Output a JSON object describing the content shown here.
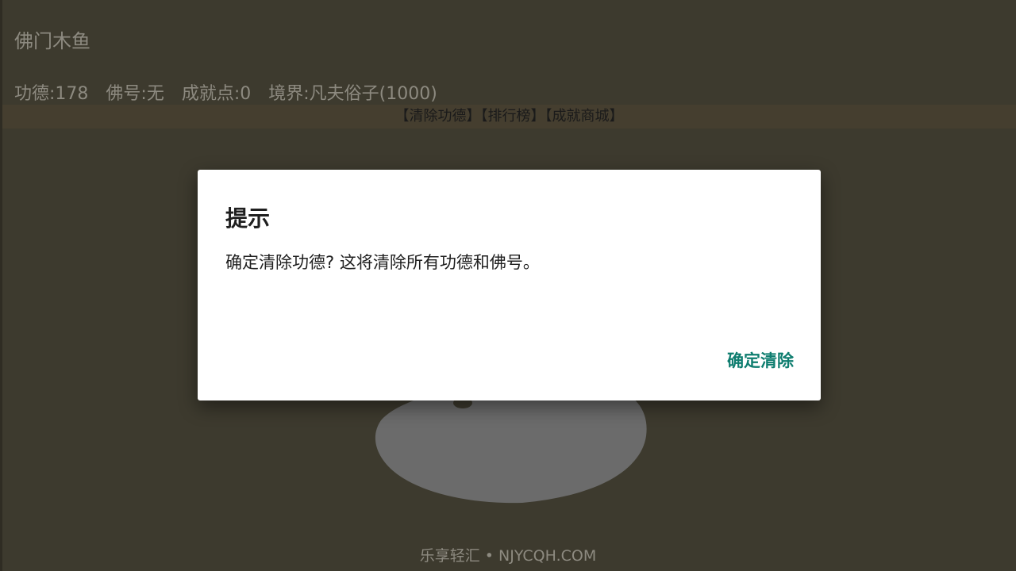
{
  "app": {
    "title": "佛门木鱼",
    "stats": {
      "merit": "功德:178",
      "buddha_name": "佛号:无",
      "achievement_points": "成就点:0",
      "realm": "境界:凡夫俗子(1000)"
    },
    "menu": {
      "clear_merit": "【清除功德】",
      "leaderboard": "【排行榜】",
      "achievement_shop": "【成就商城】"
    },
    "watermark": "乐享轻汇 • NJYCQH.COM"
  },
  "dialog": {
    "title": "提示",
    "message": "确定清除功德? 这将清除所有功德和佛号。",
    "confirm_label": "确定清除"
  },
  "colors": {
    "background": "#3d3a2e",
    "menu_bar": "#453e2f",
    "dim_text": "#8d8a80",
    "dialog_bg": "#ffffff",
    "accent": "#0e7d6f",
    "wooden_fish": "#6b6b6b"
  }
}
